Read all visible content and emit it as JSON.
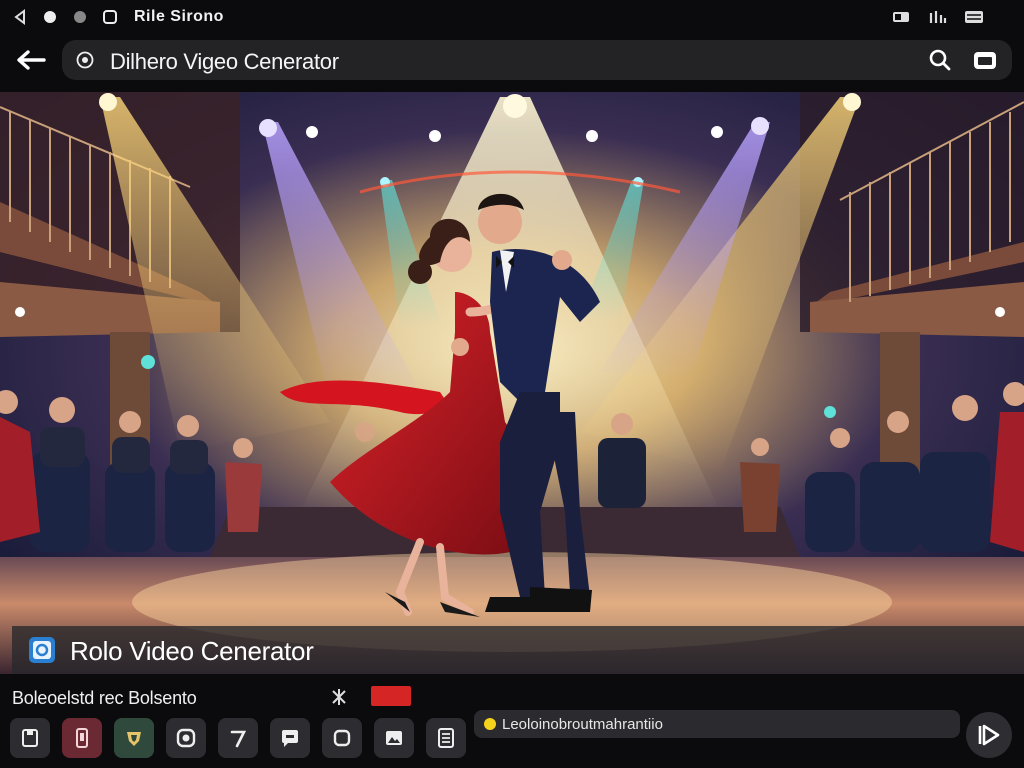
{
  "status_bar": {
    "title": "Rile Sirono",
    "left_icons": [
      "back-triangle-icon",
      "circle-icon",
      "circle-icon",
      "clock-icon"
    ],
    "right_icons": [
      "battery-icon",
      "signal-icon",
      "menu-icon"
    ]
  },
  "address_bar": {
    "title": "Dilhero Vigeo Cenerator",
    "icons": [
      "back-arrow-icon",
      "site-info-icon",
      "search-icon",
      "tabs-icon"
    ]
  },
  "video": {
    "caption": "Rolo Video Cenerator",
    "caption_icon": "app-logo-icon",
    "scene": "couple dancing on a theatre stage under spotlights"
  },
  "bottom_panel": {
    "label": "Boleoelstd rec Bolsento",
    "accent_color": "#d52525",
    "tools": [
      {
        "name": "save-icon"
      },
      {
        "name": "phone-icon",
        "color": "#6b2a33"
      },
      {
        "name": "badge-icon",
        "color": "#2f4a3c"
      },
      {
        "name": "camera-icon"
      },
      {
        "name": "number-icon"
      },
      {
        "name": "chat-icon"
      },
      {
        "name": "square-icon"
      },
      {
        "name": "image-icon"
      },
      {
        "name": "document-icon"
      }
    ],
    "prompt_text": "Leoloinobroutmahrantiio",
    "prompt_dot_color": "#f5d21c",
    "play_icon": "play-icon"
  }
}
